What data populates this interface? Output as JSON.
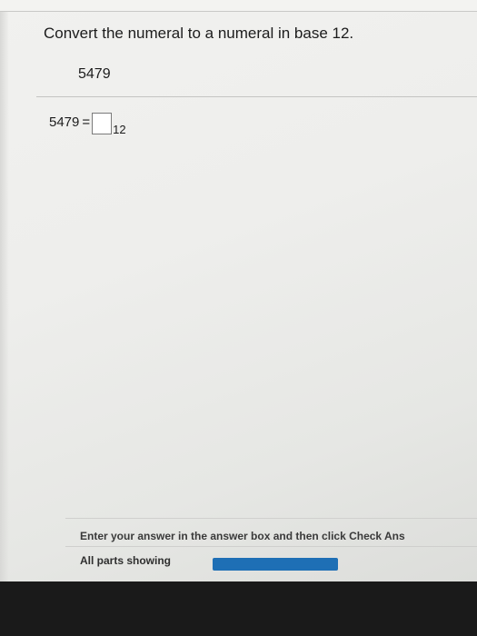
{
  "question": {
    "prompt": "Convert the numeral to a numeral in base 12.",
    "numeral": "5479"
  },
  "equation": {
    "left": "5479",
    "equals": "=",
    "answer_value": "",
    "base": "12"
  },
  "footer": {
    "instruction": "Enter your answer in the answer box and then click Check Ans",
    "parts_label": "All parts showing",
    "progress_color": "#1e6fb5"
  }
}
